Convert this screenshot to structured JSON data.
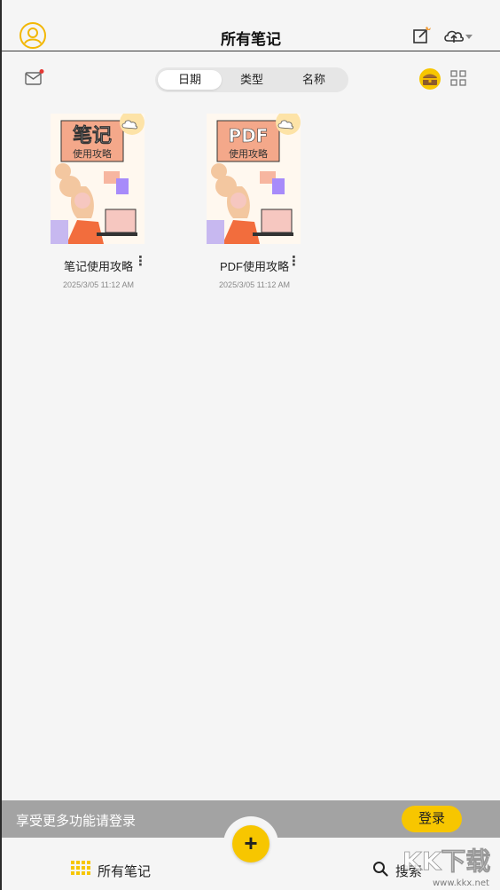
{
  "header": {
    "title": "所有笔记"
  },
  "sort_tabs": [
    {
      "label": "日期",
      "active": true
    },
    {
      "label": "类型",
      "active": false
    },
    {
      "label": "名称",
      "active": false
    }
  ],
  "notes": [
    {
      "name": "笔记使用攻略",
      "date": "2025/3/05 11:12 AM",
      "cover_title": "笔记",
      "cover_sub": "使用攻略"
    },
    {
      "name": "PDF使用攻略",
      "date": "2025/3/05 11:12 AM",
      "cover_title": "PDF",
      "cover_sub": "使用攻略"
    }
  ],
  "login_banner": {
    "text": "享受更多功能请登录",
    "button": "登录"
  },
  "bottom_nav": {
    "all_notes": "所有笔记",
    "search": "搜索",
    "fab": "+"
  },
  "watermark": "KKX下载",
  "colors": {
    "accent": "#f7c600",
    "mail_dot": "#e53935"
  }
}
